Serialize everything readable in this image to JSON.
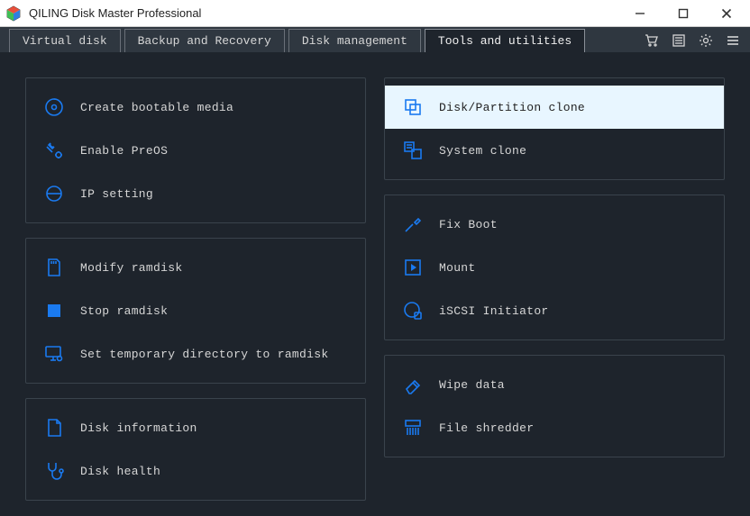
{
  "window": {
    "title": "QILING Disk Master Professional"
  },
  "tabs": {
    "virtual_disk": "Virtual disk",
    "backup_recovery": "Backup and Recovery",
    "disk_management": "Disk management",
    "tools_utilities": "Tools and utilities"
  },
  "tools": {
    "left": {
      "group1": {
        "bootable_media": "Create bootable media",
        "enable_preos": "Enable PreOS",
        "ip_setting": "IP setting"
      },
      "group2": {
        "modify_ramdisk": "Modify ramdisk",
        "stop_ramdisk": "Stop ramdisk",
        "set_temp_dir": "Set temporary directory to ramdisk"
      },
      "group3": {
        "disk_information": "Disk information",
        "disk_health": "Disk health"
      }
    },
    "right": {
      "group1": {
        "disk_partition_clone": "Disk/Partition clone",
        "system_clone": "System clone"
      },
      "group2": {
        "fix_boot": "Fix Boot",
        "mount": "Mount",
        "iscsi_initiator": "iSCSI Initiator"
      },
      "group3": {
        "wipe_data": "Wipe data",
        "file_shredder": "File shredder"
      }
    }
  },
  "colors": {
    "accent": "#1a7af0",
    "selected_bg": "#e8f6ff",
    "panel_border": "#3a434c",
    "bg": "#1e242c"
  }
}
